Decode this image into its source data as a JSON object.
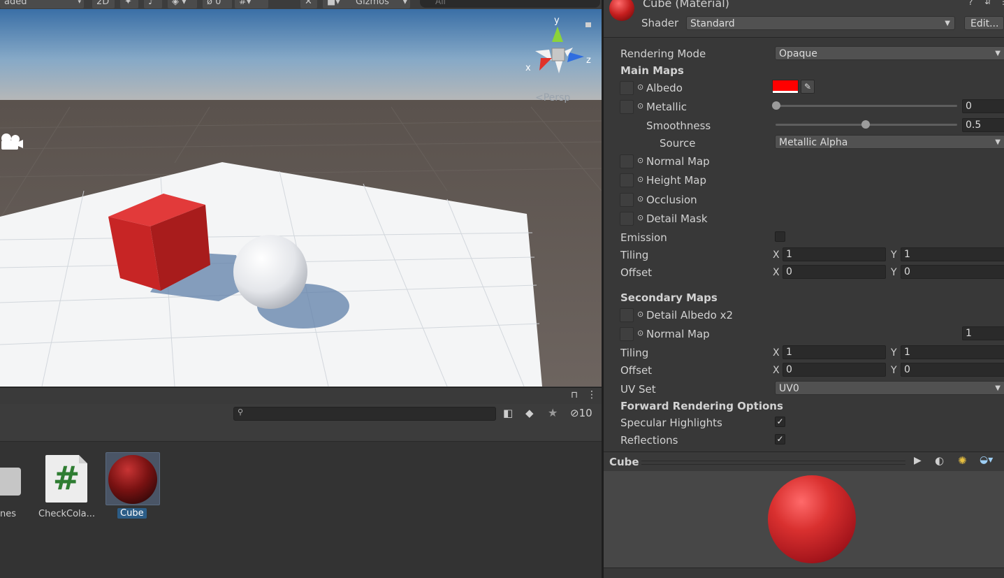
{
  "scene": {
    "toolbar": {
      "draw_mode": "aded",
      "mode_2d": "2D",
      "hidden_count": "0",
      "gizmos_label": "Gizmos",
      "search_placeholder": "All"
    },
    "gizmo": {
      "y": "y",
      "x": "x",
      "z": "z"
    },
    "persp_label": "<Persp"
  },
  "project": {
    "search_placeholder": "",
    "hidden_count": "10",
    "assets": [
      {
        "label": "nes"
      },
      {
        "label": "CheckCola..."
      },
      {
        "label": "Cube"
      }
    ],
    "script_glyph": "#"
  },
  "inspector": {
    "title": "Cube (Material)",
    "shader_label": "Shader",
    "shader_value": "Standard",
    "edit_button": "Edit...",
    "rendering_mode_label": "Rendering Mode",
    "rendering_mode_value": "Opaque",
    "main_maps_title": "Main Maps",
    "albedo_label": "Albedo",
    "albedo_color": "#ff0000",
    "metallic_label": "Metallic",
    "metallic_value": "0",
    "smoothness_label": "Smoothness",
    "smoothness_value": "0.5",
    "source_label": "Source",
    "source_value": "Metallic Alpha",
    "normal_map_label": "Normal Map",
    "height_map_label": "Height Map",
    "occlusion_label": "Occlusion",
    "detail_mask_label": "Detail Mask",
    "emission_label": "Emission",
    "tiling_label": "Tiling",
    "offset_label": "Offset",
    "x_label": "X",
    "y_label": "Y",
    "main_tiling_x": "1",
    "main_tiling_y": "1",
    "main_offset_x": "0",
    "main_offset_y": "0",
    "secondary_maps_title": "Secondary Maps",
    "detail_albedo_label": "Detail Albedo x2",
    "secondary_normal_label": "Normal Map",
    "secondary_normal_scale": "1",
    "sec_tiling_x": "1",
    "sec_tiling_y": "1",
    "sec_offset_x": "0",
    "sec_offset_y": "0",
    "uv_set_label": "UV Set",
    "uv_set_value": "UV0",
    "forward_title": "Forward Rendering Options",
    "specular_label": "Specular Highlights",
    "reflections_label": "Reflections",
    "check_glyph": "✓",
    "preview_title": "Cube"
  },
  "colors": {
    "cube_red": "#d42a2a",
    "accent_blue": "#2c5d87",
    "panel_bg": "#383838"
  }
}
